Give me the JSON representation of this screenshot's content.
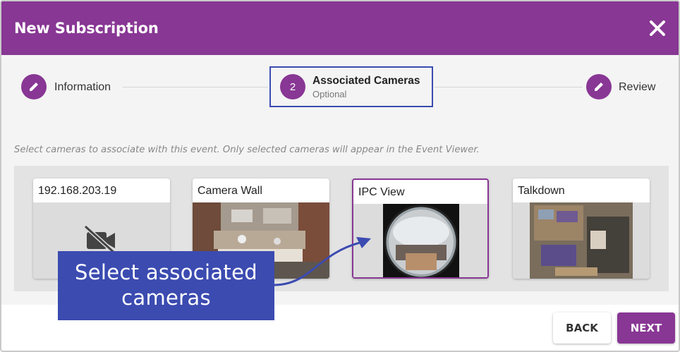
{
  "dialog": {
    "title": "New Subscription",
    "close_icon": "close-icon"
  },
  "stepper": {
    "steps": [
      {
        "label": "Information",
        "icon": "pencil-icon",
        "state": "done"
      },
      {
        "label": "Associated Cameras",
        "number": "2",
        "sublabel": "Optional",
        "state": "active"
      },
      {
        "label": "Review",
        "icon": "pencil-icon",
        "state": "pending"
      }
    ]
  },
  "instructions": "Select cameras to associate with this event. Only selected cameras will appear in the Event Viewer.",
  "cameras": [
    {
      "name": "192.168.203.19",
      "thumbnail": "no-video-icon",
      "selected": false
    },
    {
      "name": "Camera Wall",
      "thumbnail": "workshop-view",
      "selected": false
    },
    {
      "name": "IPC View",
      "thumbnail": "fisheye-view",
      "selected": true
    },
    {
      "name": "Talkdown",
      "thumbnail": "overhead-view",
      "selected": false
    }
  ],
  "actions": {
    "back_label": "BACK",
    "next_label": "NEXT"
  },
  "callout": {
    "text": "Select associated cameras"
  },
  "colors": {
    "brand": "#883794",
    "callout": "#3b4bb0"
  }
}
